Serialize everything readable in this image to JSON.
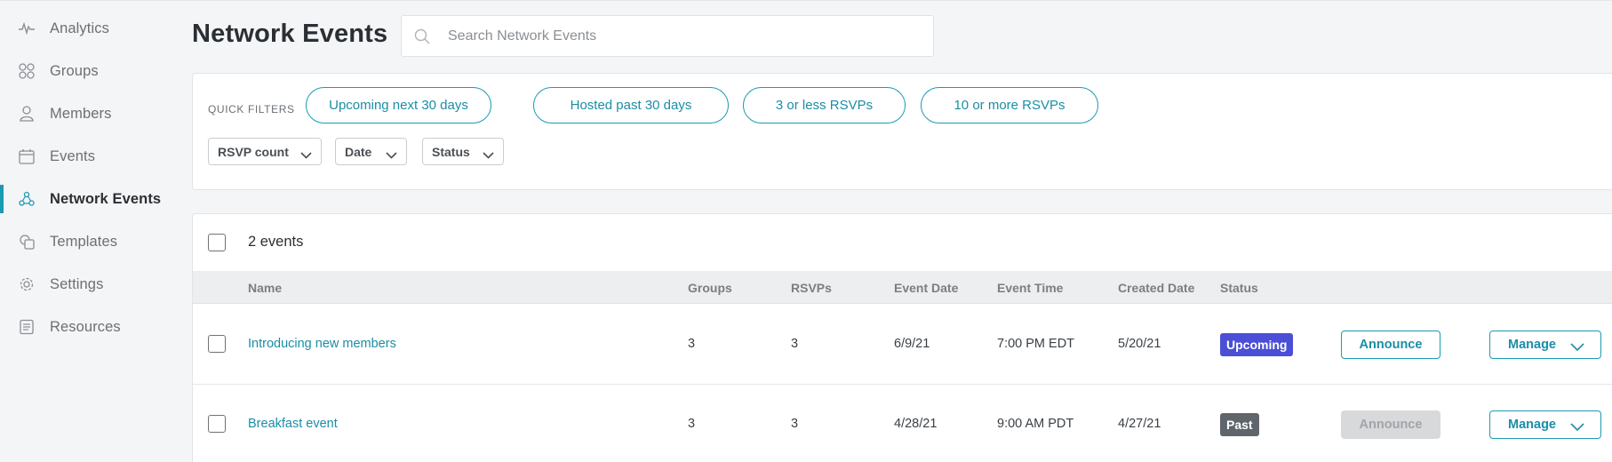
{
  "sidebar": {
    "items": [
      {
        "label": "Analytics",
        "icon": "analytics-icon"
      },
      {
        "label": "Groups",
        "icon": "groups-icon"
      },
      {
        "label": "Members",
        "icon": "members-icon"
      },
      {
        "label": "Events",
        "icon": "calendar-icon"
      },
      {
        "label": "Network Events",
        "icon": "network-icon",
        "active": true
      },
      {
        "label": "Templates",
        "icon": "templates-icon"
      },
      {
        "label": "Settings",
        "icon": "gear-icon"
      },
      {
        "label": "Resources",
        "icon": "resources-icon"
      }
    ]
  },
  "header": {
    "title": "Network Events",
    "search_placeholder": "Search Network Events"
  },
  "filters": {
    "quick_label": "QUICK FILTERS",
    "quick": [
      "Upcoming next 30 days",
      "Hosted past 30 days",
      "3 or less RSVPs",
      "10 or more RSVPs"
    ],
    "dropdowns": [
      "RSVP count",
      "Date",
      "Status"
    ]
  },
  "table": {
    "count_label": "2 events",
    "columns": [
      "Name",
      "Groups",
      "RSVPs",
      "Event Date",
      "Event Time",
      "Created Date",
      "Status"
    ],
    "rows": [
      {
        "name": "Introducing new members",
        "groups": "3",
        "rsvps": "3",
        "event_date": "6/9/21",
        "event_time": "7:00 PM EDT",
        "created_date": "5/20/21",
        "status": "Upcoming",
        "announce": "Announce",
        "manage": "Manage"
      },
      {
        "name": "Breakfast event",
        "groups": "3",
        "rsvps": "3",
        "event_date": "4/28/21",
        "event_time": "9:00 AM PDT",
        "created_date": "4/27/21",
        "status": "Past",
        "announce": "Announce",
        "manage": "Manage"
      }
    ]
  },
  "colors": {
    "accent": "#1a9bb4",
    "upcoming_badge": "#4a4fd6",
    "past_badge": "#5f656b",
    "background": "#f4f5f6"
  }
}
